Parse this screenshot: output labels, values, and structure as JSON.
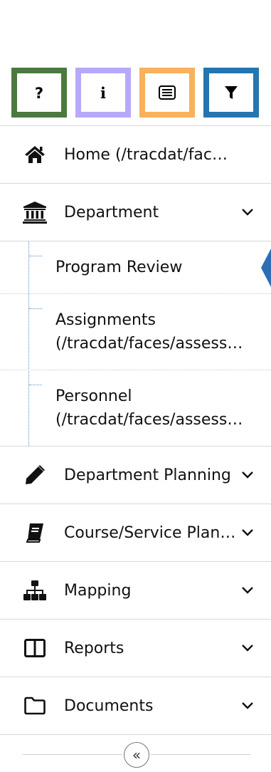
{
  "shortcuts": [
    {
      "name": "help-shortcut",
      "icon": "question-icon",
      "border_color": "#4a7a3e"
    },
    {
      "name": "info-shortcut",
      "icon": "info-icon",
      "border_color": "#b7a9fa"
    },
    {
      "name": "list-shortcut",
      "icon": "list-card-icon",
      "border_color": "#f8b15c"
    },
    {
      "name": "filter-shortcut",
      "icon": "filter-icon",
      "border_color": "#2575b0"
    }
  ],
  "nav": {
    "home": {
      "label": "Home (/tracdat/fac…",
      "icon": "home-icon"
    },
    "department": {
      "label": "Department",
      "icon": "bank-icon",
      "expanded": true,
      "items": [
        {
          "lines": [
            "Program Review"
          ],
          "active": true
        },
        {
          "lines": [
            "Assignments",
            "(/tracdat/faces/assess…"
          ]
        },
        {
          "lines": [
            "Personnel",
            "(/tracdat/faces/assess…"
          ]
        }
      ]
    },
    "department_planning": {
      "label": "Department Planning",
      "icon": "pencil-icon"
    },
    "course_service": {
      "label": "Course/Service Plan…",
      "icon": "book-icon"
    },
    "mapping": {
      "label": "Mapping",
      "icon": "sitemap-icon"
    },
    "reports": {
      "label": "Reports",
      "icon": "columns-icon"
    },
    "documents": {
      "label": "Documents",
      "icon": "folder-icon"
    }
  },
  "collapse": {
    "symbol": "«",
    "icon": "double-chevron-left-icon"
  },
  "colors": {
    "accent": "#2d6db6",
    "connector": "#5a8fc0",
    "divider": "#d9d9d9"
  }
}
